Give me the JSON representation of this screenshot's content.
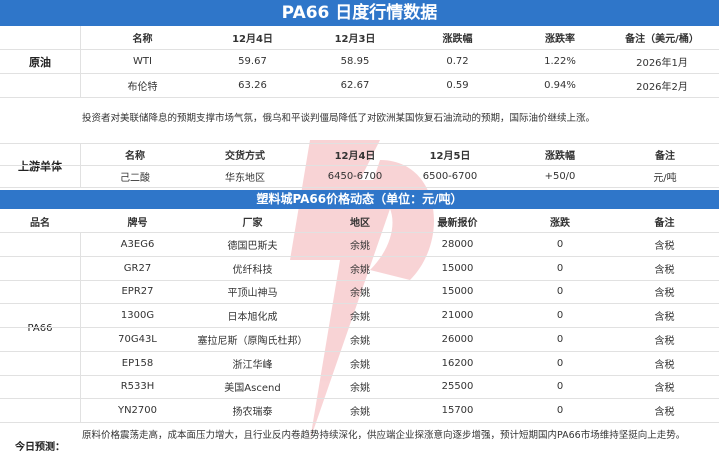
{
  "title": "PA66 日度行情数据",
  "crude": {
    "section_label": "原油",
    "headers": [
      "名称",
      "12月4日",
      "12月3日",
      "涨跌幅",
      "涨跌率",
      "备注（美元/桶）"
    ],
    "rows": [
      [
        "WTI",
        "59.67",
        "58.95",
        "0.72",
        "1.22%",
        "2026年1月"
      ],
      [
        "布伦特",
        "63.26",
        "62.67",
        "0.59",
        "0.94%",
        "2026年2月"
      ]
    ],
    "note": "投资者对美联储降息的预期支撑市场气氛，俄乌和平谈判僵局降低了对欧洲某国恢复石油流动的预期，国际油价继续上涨。"
  },
  "monomer": {
    "section_label": "上游单体",
    "headers": [
      "名称",
      "交货方式",
      "12月4日",
      "12月5日",
      "涨跌幅",
      "备注"
    ],
    "rows": [
      [
        "己二酸",
        "华东地区",
        "6450-6700",
        "6500-6700",
        "+50/0",
        "元/吨"
      ]
    ]
  },
  "pa66": {
    "band_title": "塑料城PA66价格动态（单位：元/吨）",
    "headers": [
      "品名",
      "牌号",
      "厂家",
      "地区",
      "最新报价",
      "涨跌",
      "备注"
    ],
    "product": "PA66",
    "rows": [
      [
        "A3EG6",
        "德国巴斯夫",
        "余姚",
        "28000",
        "0",
        "含税"
      ],
      [
        "GR27",
        "优纤科技",
        "余姚",
        "15000",
        "0",
        "含税"
      ],
      [
        "EPR27",
        "平顶山神马",
        "余姚",
        "15000",
        "0",
        "含税"
      ],
      [
        "1300G",
        "日本旭化成",
        "余姚",
        "21000",
        "0",
        "含税"
      ],
      [
        "70G43L",
        "塞拉尼斯（原陶氏杜邦）",
        "余姚",
        "26000",
        "0",
        "含税"
      ],
      [
        "EP158",
        "浙江华峰",
        "余姚",
        "16200",
        "0",
        "含税"
      ],
      [
        "R533H",
        "美国Ascend",
        "余姚",
        "25500",
        "0",
        "含税"
      ],
      [
        "YN2700",
        "扬农瑞泰",
        "余姚",
        "15700",
        "0",
        "含税"
      ]
    ]
  },
  "forecast": {
    "label": "今日预测：",
    "text": "原料价格震荡走高，成本面压力增大，且行业反内卷趋势持续深化，供应端企业探涨意向逐步增强，预计短期国内PA66市场维持坚挺向上走势。"
  },
  "colors": {
    "accent": "#2f76c9",
    "watermark": "#e23b46"
  }
}
